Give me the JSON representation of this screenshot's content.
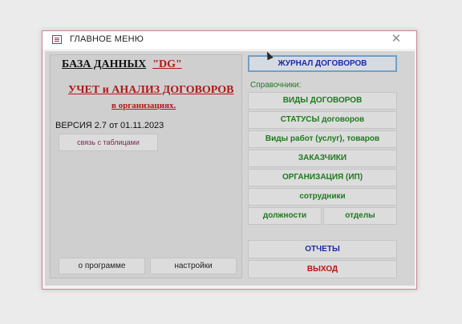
{
  "window": {
    "title": "ГЛАВНОЕ МЕНЮ",
    "close_glyph": "✕"
  },
  "left": {
    "db_label": "БАЗА ДАННЫХ",
    "db_name": "\"DG\"",
    "headline": "УЧЕТ и АНАЛИЗ ДОГОВОРОВ",
    "subline": "в организациях.",
    "version": "ВЕРСИЯ 2.7 от 01.11.2023",
    "link_button": "связь с таблицами",
    "about_button": "о программе",
    "settings_button": "настройки"
  },
  "right": {
    "journal_button": "ЖУРНАЛ ДОГОВОРОВ",
    "references_label": "Справочники:",
    "contract_types_button": "ВИДЫ ДОГОВОРОВ",
    "statuses_button": "СТАТУСЫ договоров",
    "works_button": "Виды работ (услуг), товаров",
    "customers_button": "ЗАКАЗЧИКИ",
    "organization_button": "ОРГАНИЗАЦИЯ (ИП)",
    "staff_button": "сотрудники",
    "positions_button": "должности",
    "departments_button": "отделы",
    "reports_button": "ОТЧЕТЫ",
    "exit_button": "ВЫХОД"
  },
  "colors": {
    "accent_red": "#b01818",
    "accent_green": "#1f7a1f",
    "accent_blue": "#1e2aa0"
  }
}
